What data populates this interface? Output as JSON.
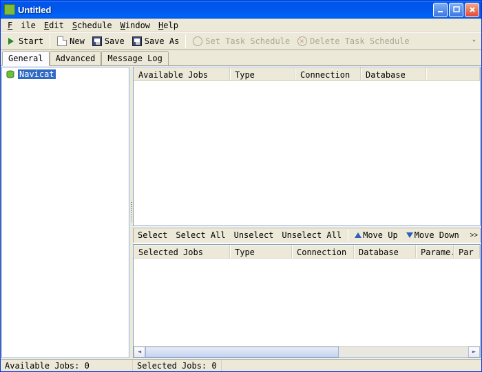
{
  "window": {
    "title": "Untitled"
  },
  "menu": {
    "file": "File",
    "edit": "Edit",
    "schedule": "Schedule",
    "window": "Window",
    "help": "Help"
  },
  "toolbar": {
    "start": "Start",
    "new": "New",
    "save": "Save",
    "saveas": "Save As",
    "settask": "Set Task Schedule",
    "deltask": "Delete Task Schedule"
  },
  "tabs": {
    "general": "General",
    "advanced": "Advanced",
    "msglog": "Message Log"
  },
  "tree": {
    "root": "Navicat"
  },
  "cols_top": {
    "available": "Available Jobs",
    "type": "Type",
    "conn": "Connection",
    "db": "Database"
  },
  "mid": {
    "select": "Select",
    "selectall": "Select All",
    "unselect": "Unselect",
    "unselectall": "Unselect All",
    "moveup": "Move Up",
    "movedown": "Move Down",
    "expand": ">>"
  },
  "cols_bot": {
    "selected": "Selected Jobs",
    "type": "Type",
    "conn": "Connection",
    "db": "Database",
    "params": "Parame...",
    "par": "Par"
  },
  "status": {
    "avail": "Available Jobs: 0",
    "sel": "Selected Jobs: 0"
  }
}
